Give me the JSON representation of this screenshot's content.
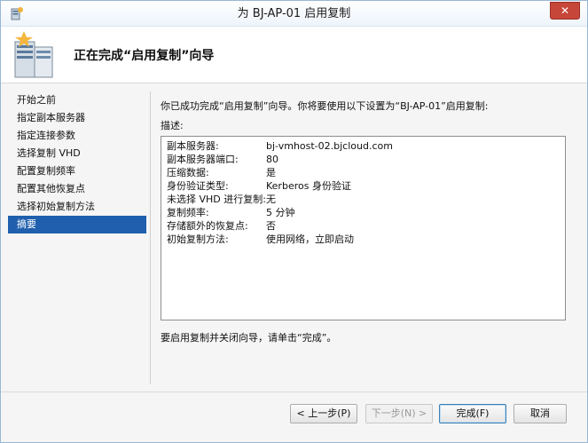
{
  "window": {
    "title": "为 BJ-AP-01 启用复制",
    "close_label": "✕"
  },
  "header": {
    "heading": "正在完成“启用复制”向导"
  },
  "sidebar": {
    "items": [
      {
        "label": "开始之前"
      },
      {
        "label": "指定副本服务器"
      },
      {
        "label": "指定连接参数"
      },
      {
        "label": "选择复制 VHD"
      },
      {
        "label": "配置复制频率"
      },
      {
        "label": "配置其他恢复点"
      },
      {
        "label": "选择初始复制方法"
      },
      {
        "label": "摘要"
      }
    ],
    "active_index": 7
  },
  "main": {
    "intro": "你已成功完成“启用复制”向导。你将要使用以下设置为“BJ-AP-01”启用复制:",
    "description_label": "描述:",
    "settings": [
      {
        "key": "副本服务器:",
        "value": "bj-vmhost-02.bjcloud.com"
      },
      {
        "key": "副本服务器端口:",
        "value": "80"
      },
      {
        "key": "压缩数据:",
        "value": "是"
      },
      {
        "key": "身份验证类型:",
        "value": "Kerberos 身份验证"
      },
      {
        "key": "未选择 VHD 进行复制:",
        "value": "无"
      },
      {
        "key": "复制频率:",
        "value": "5 分钟"
      },
      {
        "key": "存储额外的恢复点:",
        "value": "否"
      },
      {
        "key": "初始复制方法:",
        "value": "使用网络，立即启动"
      }
    ],
    "finish_note": "要启用复制并关闭向导，请单击“完成”。"
  },
  "buttons": {
    "previous": "< 上一步(P)",
    "next": "下一步(N) >",
    "finish": "完成(F)",
    "cancel": "取消"
  }
}
